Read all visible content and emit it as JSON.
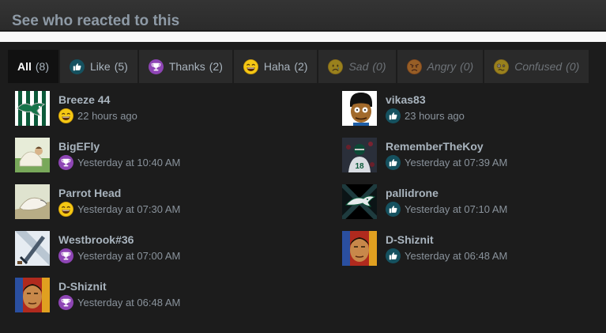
{
  "header": {
    "title": "See who reacted to this"
  },
  "tabs": [
    {
      "label": "All",
      "count": "(8)",
      "icon": ""
    },
    {
      "label": "Like",
      "count": "(5)",
      "icon": "like-icon"
    },
    {
      "label": "Thanks",
      "count": "(2)",
      "icon": "thanks-icon"
    },
    {
      "label": "Haha",
      "count": "(2)",
      "icon": "haha-icon"
    },
    {
      "label": "Sad",
      "count": "(0)",
      "icon": "sad-icon"
    },
    {
      "label": "Angry",
      "count": "(0)",
      "icon": "angry-icon"
    },
    {
      "label": "Confused",
      "count": "(0)",
      "icon": "confused-icon"
    }
  ],
  "reactions": [
    {
      "user": "Breeze 44",
      "time": "22 hours ago",
      "reaction": "haha-icon",
      "avatar": "eagles-stripes-avatar"
    },
    {
      "user": "vikas83",
      "time": "23 hours ago",
      "reaction": "like-icon",
      "avatar": "cartoon-shopkeeper-avatar"
    },
    {
      "user": "BigEFly",
      "time": "Yesterday at 10:40 AM",
      "reaction": "thanks-icon",
      "avatar": "figure-on-green-avatar"
    },
    {
      "user": "RememberTheKoy",
      "time": "Yesterday at 07:39 AM",
      "reaction": "like-icon",
      "avatar": "football-player-avatar"
    },
    {
      "user": "Parrot Head",
      "time": "Yesterday at 07:30 AM",
      "reaction": "haha-icon",
      "avatar": "parrot-avatar"
    },
    {
      "user": "pallidrone",
      "time": "Yesterday at 07:10 AM",
      "reaction": "like-icon",
      "avatar": "eagle-logo-avatar"
    },
    {
      "user": "Westbrook#36",
      "time": "Yesterday at 07:00 AM",
      "reaction": "thanks-icon",
      "avatar": "sword-avatar"
    },
    {
      "user": "D-Shiznit",
      "time": "Yesterday at 06:48 AM",
      "reaction": "like-icon",
      "avatar": "boxer-portrait-avatar"
    },
    {
      "user": "D-Shiznit",
      "time": "Yesterday at 06:48 AM",
      "reaction": "thanks-icon",
      "avatar": "boxer-portrait-avatar"
    }
  ],
  "colors": {
    "like": "#15515f",
    "thanks": "#8e45b5",
    "haha": "#f5c814",
    "text": "#a9b4be"
  }
}
